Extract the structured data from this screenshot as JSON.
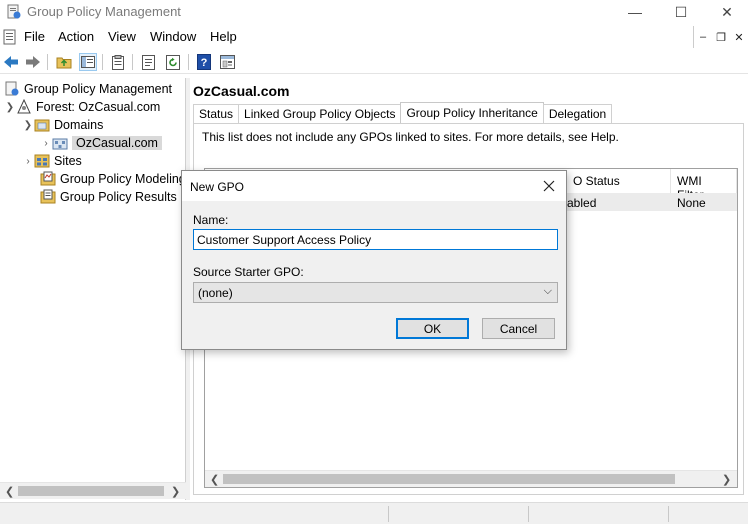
{
  "window": {
    "title": "Group Policy Management",
    "minimize_glyph": "—",
    "maximize_glyph": "☐",
    "close_glyph": "✕"
  },
  "menubar": {
    "items": [
      "File",
      "Action",
      "View",
      "Window",
      "Help"
    ],
    "mdi": {
      "minimize": "–",
      "restore": "❐",
      "close": "✕"
    }
  },
  "toolbar": {
    "icons": [
      "back-arrow-icon",
      "forward-arrow-icon",
      "up-folder-icon",
      "show-hide-tree-icon",
      "clipboard-icon",
      "properties-icon",
      "refresh-icon",
      "help-icon",
      "mmc-icon"
    ]
  },
  "tree": {
    "root": "Group Policy Management",
    "forest": "Forest: OzCasual.com",
    "domains": "Domains",
    "domain": "OzCasual.com",
    "sites": "Sites",
    "modeling": "Group Policy Modeling",
    "results": "Group Policy Results"
  },
  "content": {
    "title": "OzCasual.com",
    "tabs": [
      "Status",
      "Linked Group Policy Objects",
      "Group Policy Inheritance",
      "Delegation"
    ],
    "active_tab": "Group Policy Inheritance",
    "info": "This list does not include any GPOs linked to sites. For more details, see Help.",
    "columns": [
      "O Status",
      "WMI Filter"
    ],
    "row": {
      "gpo_status": "abled",
      "wmi_filter": "None"
    }
  },
  "dialog": {
    "title": "New GPO",
    "name_label": "Name:",
    "name_value": "Customer Support Access Policy",
    "source_label": "Source Starter GPO:",
    "source_value": "(none)",
    "ok": "OK",
    "cancel": "Cancel"
  },
  "colors": {
    "accent": "#0078d7",
    "selection": "#d9d9d9",
    "dialog_bg": "#f0f0f0"
  }
}
